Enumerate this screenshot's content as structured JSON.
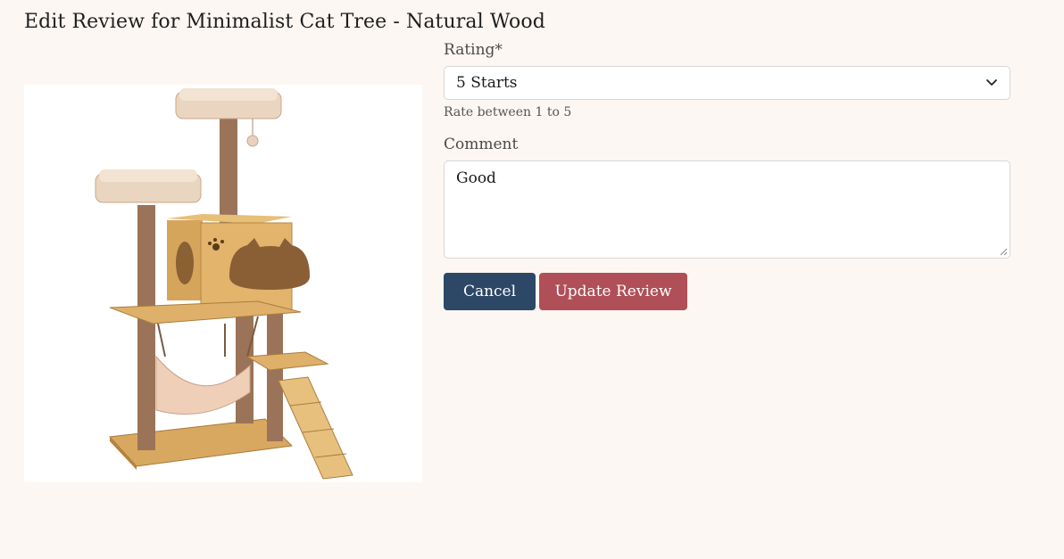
{
  "page": {
    "title": "Edit Review for Minimalist Cat Tree - Natural Wood"
  },
  "product": {
    "image_description_icon": "cat-tree-product-image"
  },
  "form": {
    "rating": {
      "label": "Rating*",
      "selected": "5 Starts",
      "help": "Rate between 1 to 5"
    },
    "comment": {
      "label": "Comment",
      "value": "Good"
    },
    "cancel_label": "Cancel",
    "update_label": "Update Review"
  },
  "colors": {
    "background": "#fdf7f3",
    "cancel": "#2c4866",
    "update": "#b04f58"
  }
}
